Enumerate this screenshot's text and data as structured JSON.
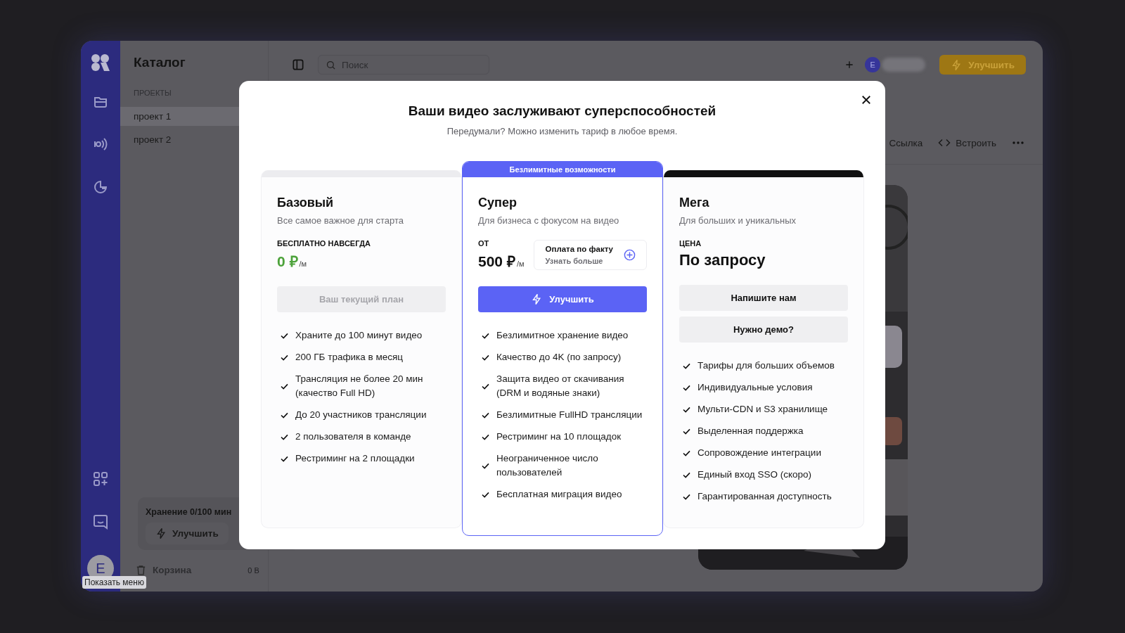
{
  "app": {
    "rail": {
      "avatar": "E"
    },
    "tooltip": "Показать меню",
    "panel": {
      "title": "Каталог",
      "section": "ПРОЕКТЫ",
      "projects": [
        {
          "label": "проект 1",
          "selected": true
        },
        {
          "label": "проект 2",
          "selected": false
        }
      ],
      "storage": "Хранение 0/100 мин",
      "upgrade": "Улучшить",
      "trash": "Корзина",
      "trash_size": "0 B"
    },
    "topbar": {
      "search_placeholder": "Поиск",
      "avatar": "E",
      "upgrade": "Улучшить"
    },
    "actions": [
      {
        "label": "Ссылка",
        "kind": "link"
      },
      {
        "label": "Встроить",
        "kind": "embed"
      }
    ]
  },
  "modal": {
    "title": "Ваши видео заслуживают суперспособностей",
    "subtitle": "Передумали? Можно изменить тариф в любое время.",
    "plans": [
      {
        "name": "Базовый",
        "description": "Все самое важное для старта",
        "color": "#ececef",
        "kind": "free",
        "price_label": "БЕСПЛАТНО НАВСЕГДА",
        "price": "0 ₽",
        "unit": "/м",
        "buttons": [
          {
            "label": "Ваш текущий план",
            "kind": "secondary",
            "disabled": true
          }
        ],
        "features": [
          "Храните до 100 минут видео",
          "200 ГБ трафика в месяц",
          "Трансляция не более 20 мин (качество Full HD)",
          "До 20 участников трансляции",
          "2 пользователя в команде",
          "Рестриминг на 2 площадки"
        ]
      },
      {
        "name": "Супер",
        "description": "Для бизнеса с фокусом на видео",
        "color": "#5b63f5",
        "banner": "Безлимитные возможности",
        "kind": "paid",
        "price_label": "ОТ",
        "price": "500 ₽",
        "unit": "/м",
        "info": {
          "title": "Оплата по факту",
          "link": "Узнать больше"
        },
        "buttons": [
          {
            "label": "Улучшить",
            "kind": "primary",
            "disabled": false
          }
        ],
        "features": [
          "Безлимитное хранение видео",
          "Качество до 4K (по запросу)",
          "Защита видео от скачивания (DRM и водяные знаки)",
          "Безлимитные FullHD трансляции",
          "Рестриминг на 10 площадок",
          "Неограниченное число пользователей",
          "Бесплатная миграция видео"
        ]
      },
      {
        "name": "Мега",
        "description": "Для больших и уникальных",
        "color": "#111111",
        "kind": "custom",
        "price_label": "ЦЕНА",
        "price": "По запросу",
        "buttons": [
          {
            "label": "Напишите нам",
            "kind": "secondary",
            "disabled": false
          },
          {
            "label": "Нужно демо?",
            "kind": "secondary",
            "disabled": false
          }
        ],
        "features": [
          "Тарифы для больших объемов",
          "Индивидуальные условия",
          "Мульти-CDN и S3 хранилище",
          "Выделенная поддержка",
          "Сопровождение интеграции",
          "Единый вход SSO (скоро)",
          "Гарантированная доступность"
        ]
      }
    ]
  }
}
